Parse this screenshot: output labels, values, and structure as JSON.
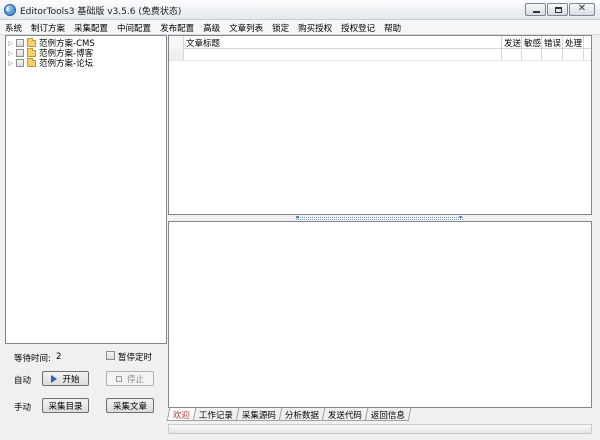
{
  "window": {
    "title": "EditorTools3 基础版 v3.5.6 (免费状态)",
    "icon": "app-logo-icon"
  },
  "menu": [
    "系统",
    "制订方案",
    "采集配置",
    "中间配置",
    "发布配置",
    "高级",
    "文章列表",
    "锁定",
    "购买授权",
    "授权登记",
    "帮助"
  ],
  "tree": {
    "items": [
      {
        "label": "范例方案-CMS"
      },
      {
        "label": "范例方案-博客"
      },
      {
        "label": "范例方案-论坛"
      }
    ]
  },
  "controls": {
    "wait_label": "等待时间:",
    "wait_value": "2",
    "pause_timer_label": "暂停定时",
    "auto_label": "自动",
    "start_label": "开始",
    "stop_label": "停止",
    "manual_label": "手动",
    "collect_dir_label": "采集目录",
    "collect_article_label": "采集文章"
  },
  "article_list": {
    "columns": [
      "文章标题",
      "发送",
      "敏感",
      "错误",
      "处理"
    ]
  },
  "tabs": [
    {
      "label": "欢迎",
      "active": true
    },
    {
      "label": "工作记录",
      "active": false
    },
    {
      "label": "采集源码",
      "active": false
    },
    {
      "label": "分析数据",
      "active": false
    },
    {
      "label": "发送代码",
      "active": false
    },
    {
      "label": "返回信息",
      "active": false
    }
  ],
  "colors": {
    "active_tab_text": "#c0392b",
    "start_icon": "#1f64b5"
  }
}
